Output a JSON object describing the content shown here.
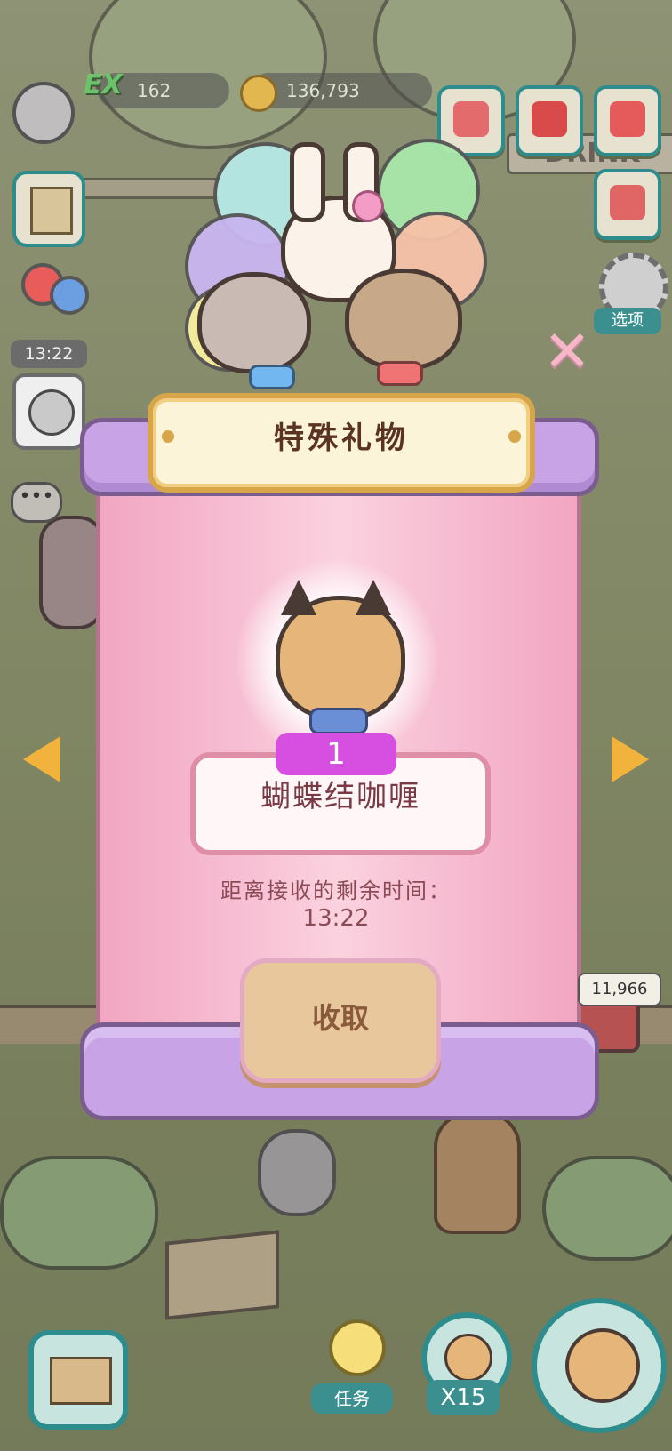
{
  "hud": {
    "ex_label": "EX",
    "ex_value": "162",
    "coin_value": "136,793"
  },
  "sidebar": {
    "balloon_timer": "13:22"
  },
  "options": {
    "label": "选项"
  },
  "sign": {
    "text": "DRINK"
  },
  "gift_panel": {
    "title": "特殊礼物",
    "count": "1",
    "item_name": "蝴蝶结咖喱",
    "remaining_label": "距离接收的剩余时间：",
    "remaining_time": "13:22",
    "collect_label": "收取"
  },
  "stand": {
    "value": "11,966"
  },
  "bottom": {
    "task_label": "任务",
    "multiplier": "X15"
  }
}
